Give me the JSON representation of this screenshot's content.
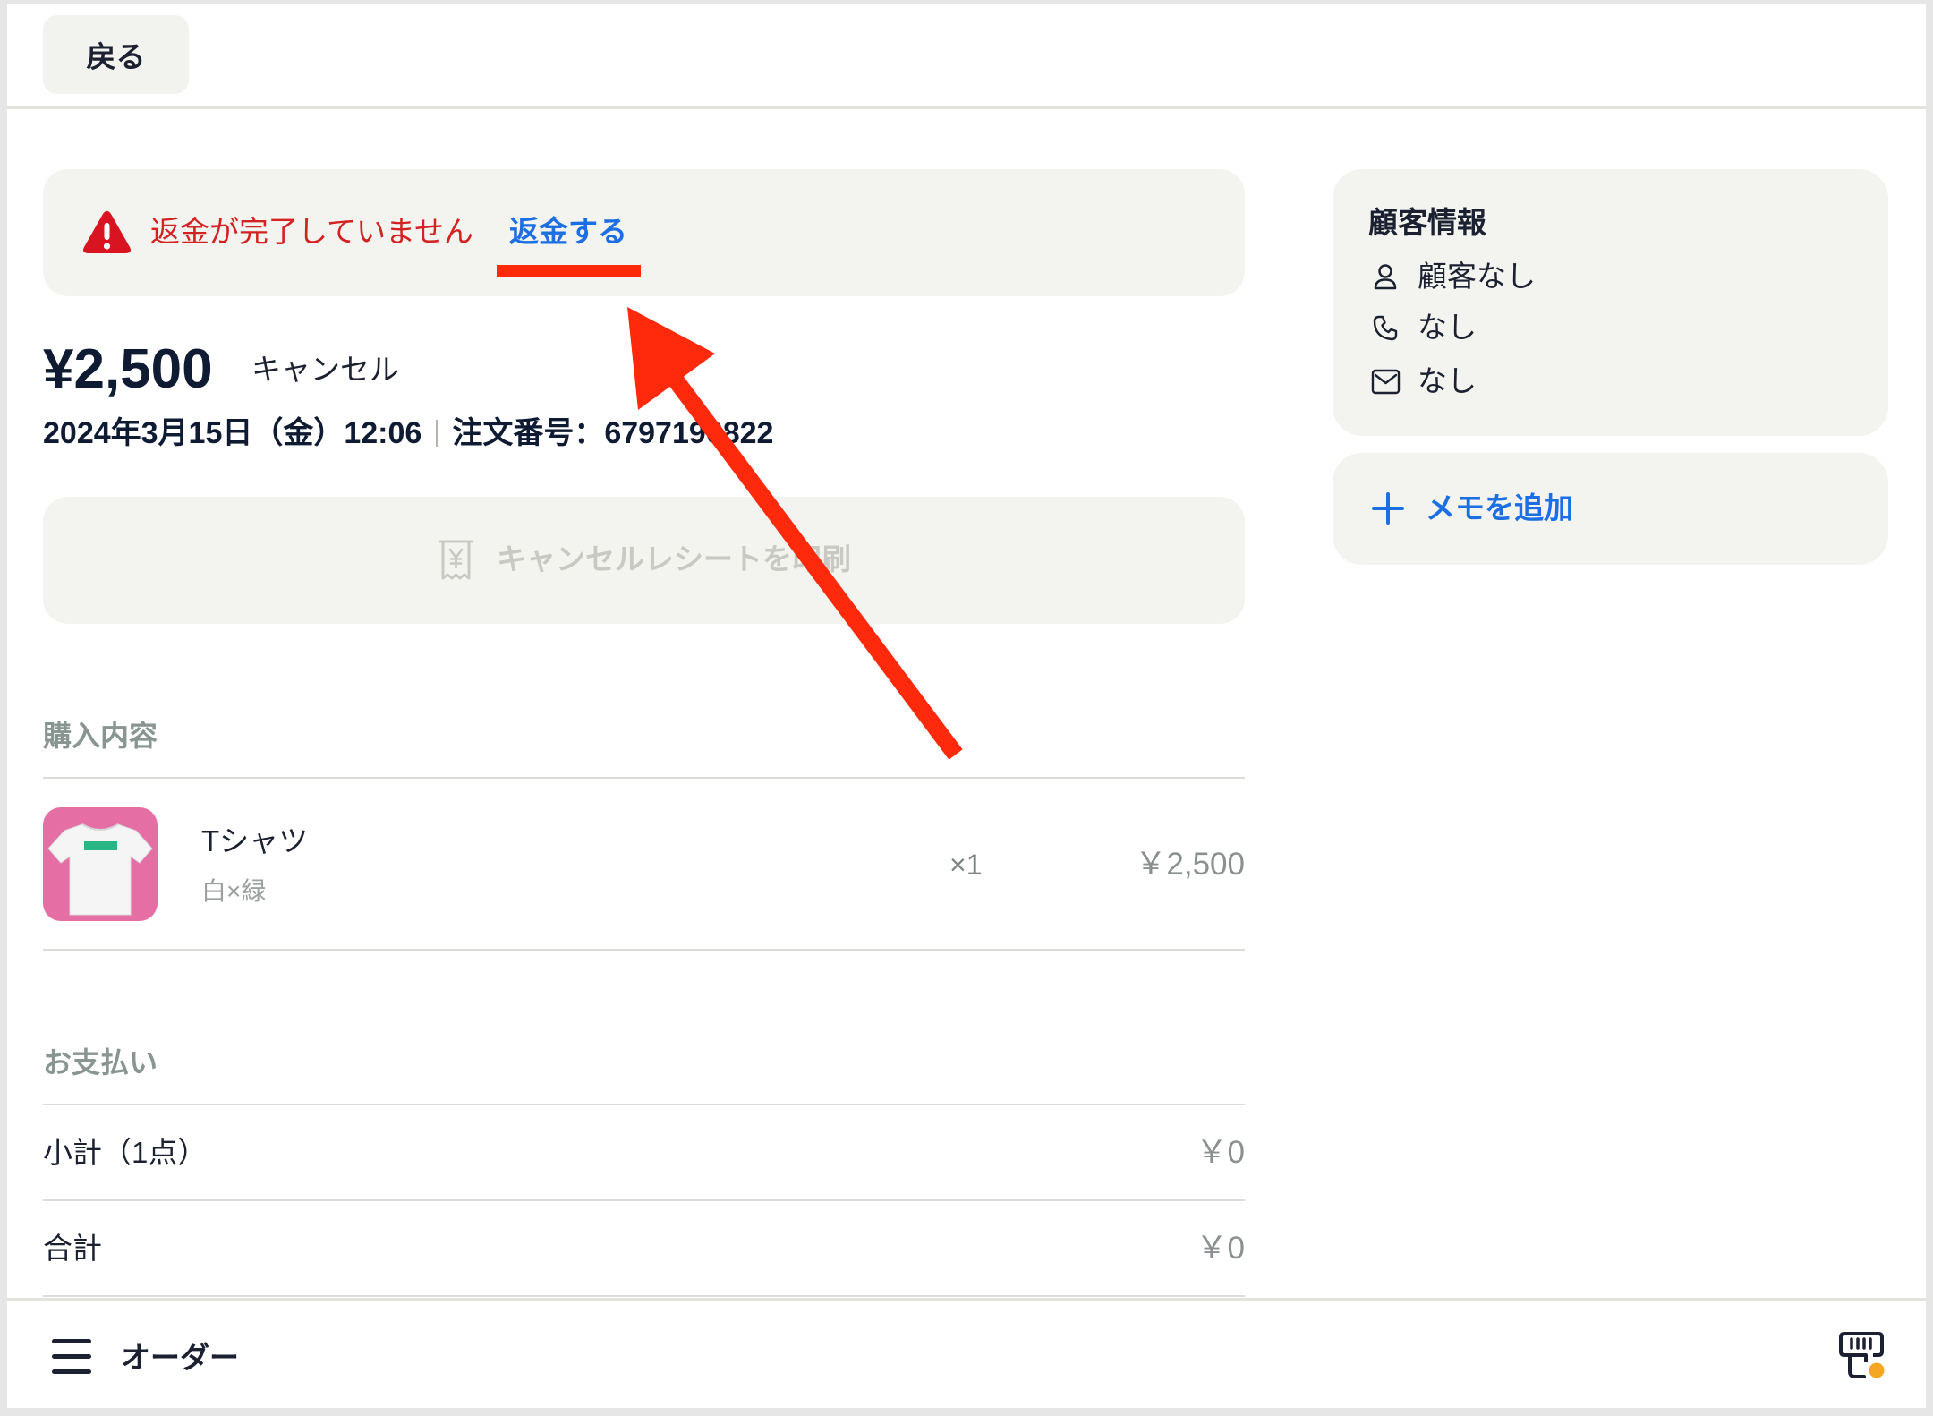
{
  "header": {
    "back_label": "戻る"
  },
  "alert": {
    "icon": "warning-icon",
    "message": "返金が完了していません",
    "action_label": "返金する"
  },
  "order": {
    "amount": "¥2,500",
    "status": "キャンセル",
    "datetime": "2024年3月15日（金）12:06",
    "order_number_label": "注文番号：",
    "order_number": "6797196822"
  },
  "receipt_button": {
    "icon": "receipt-yen-icon",
    "label": "キャンセルレシートを印刷",
    "disabled": true
  },
  "purchase": {
    "section_title": "購入内容",
    "items": [
      {
        "thumbnail_icon": "tshirt-icon",
        "name": "Tシャツ",
        "variant": "白×緑",
        "quantity": "×1",
        "price": "￥2,500"
      }
    ]
  },
  "payment": {
    "section_title": "お支払い",
    "rows": [
      {
        "label": "小計（1点）",
        "value": "￥0"
      },
      {
        "label": "合計",
        "value": "￥0"
      }
    ]
  },
  "customer": {
    "title": "顧客情報",
    "name": "顧客なし",
    "phone": "なし",
    "email": "なし",
    "icons": [
      "person-icon",
      "phone-icon",
      "mail-icon"
    ]
  },
  "memo": {
    "icon": "plus-icon",
    "add_label": "メモを追加"
  },
  "footer": {
    "menu_icon": "menu-icon",
    "title": "オーダー",
    "right_icon": "register-icon"
  },
  "colors": {
    "alert_text": "#d42121",
    "alert_icon": "#d7141f",
    "link": "#1b6fe2",
    "annotation": "#ff2a0c",
    "card_background": "#f3f3ef",
    "disabled_text": "#c9c9c4",
    "section_title": "#889590",
    "product_thumbnail": "#e56ea4",
    "badge_dot": "#f5a623"
  }
}
